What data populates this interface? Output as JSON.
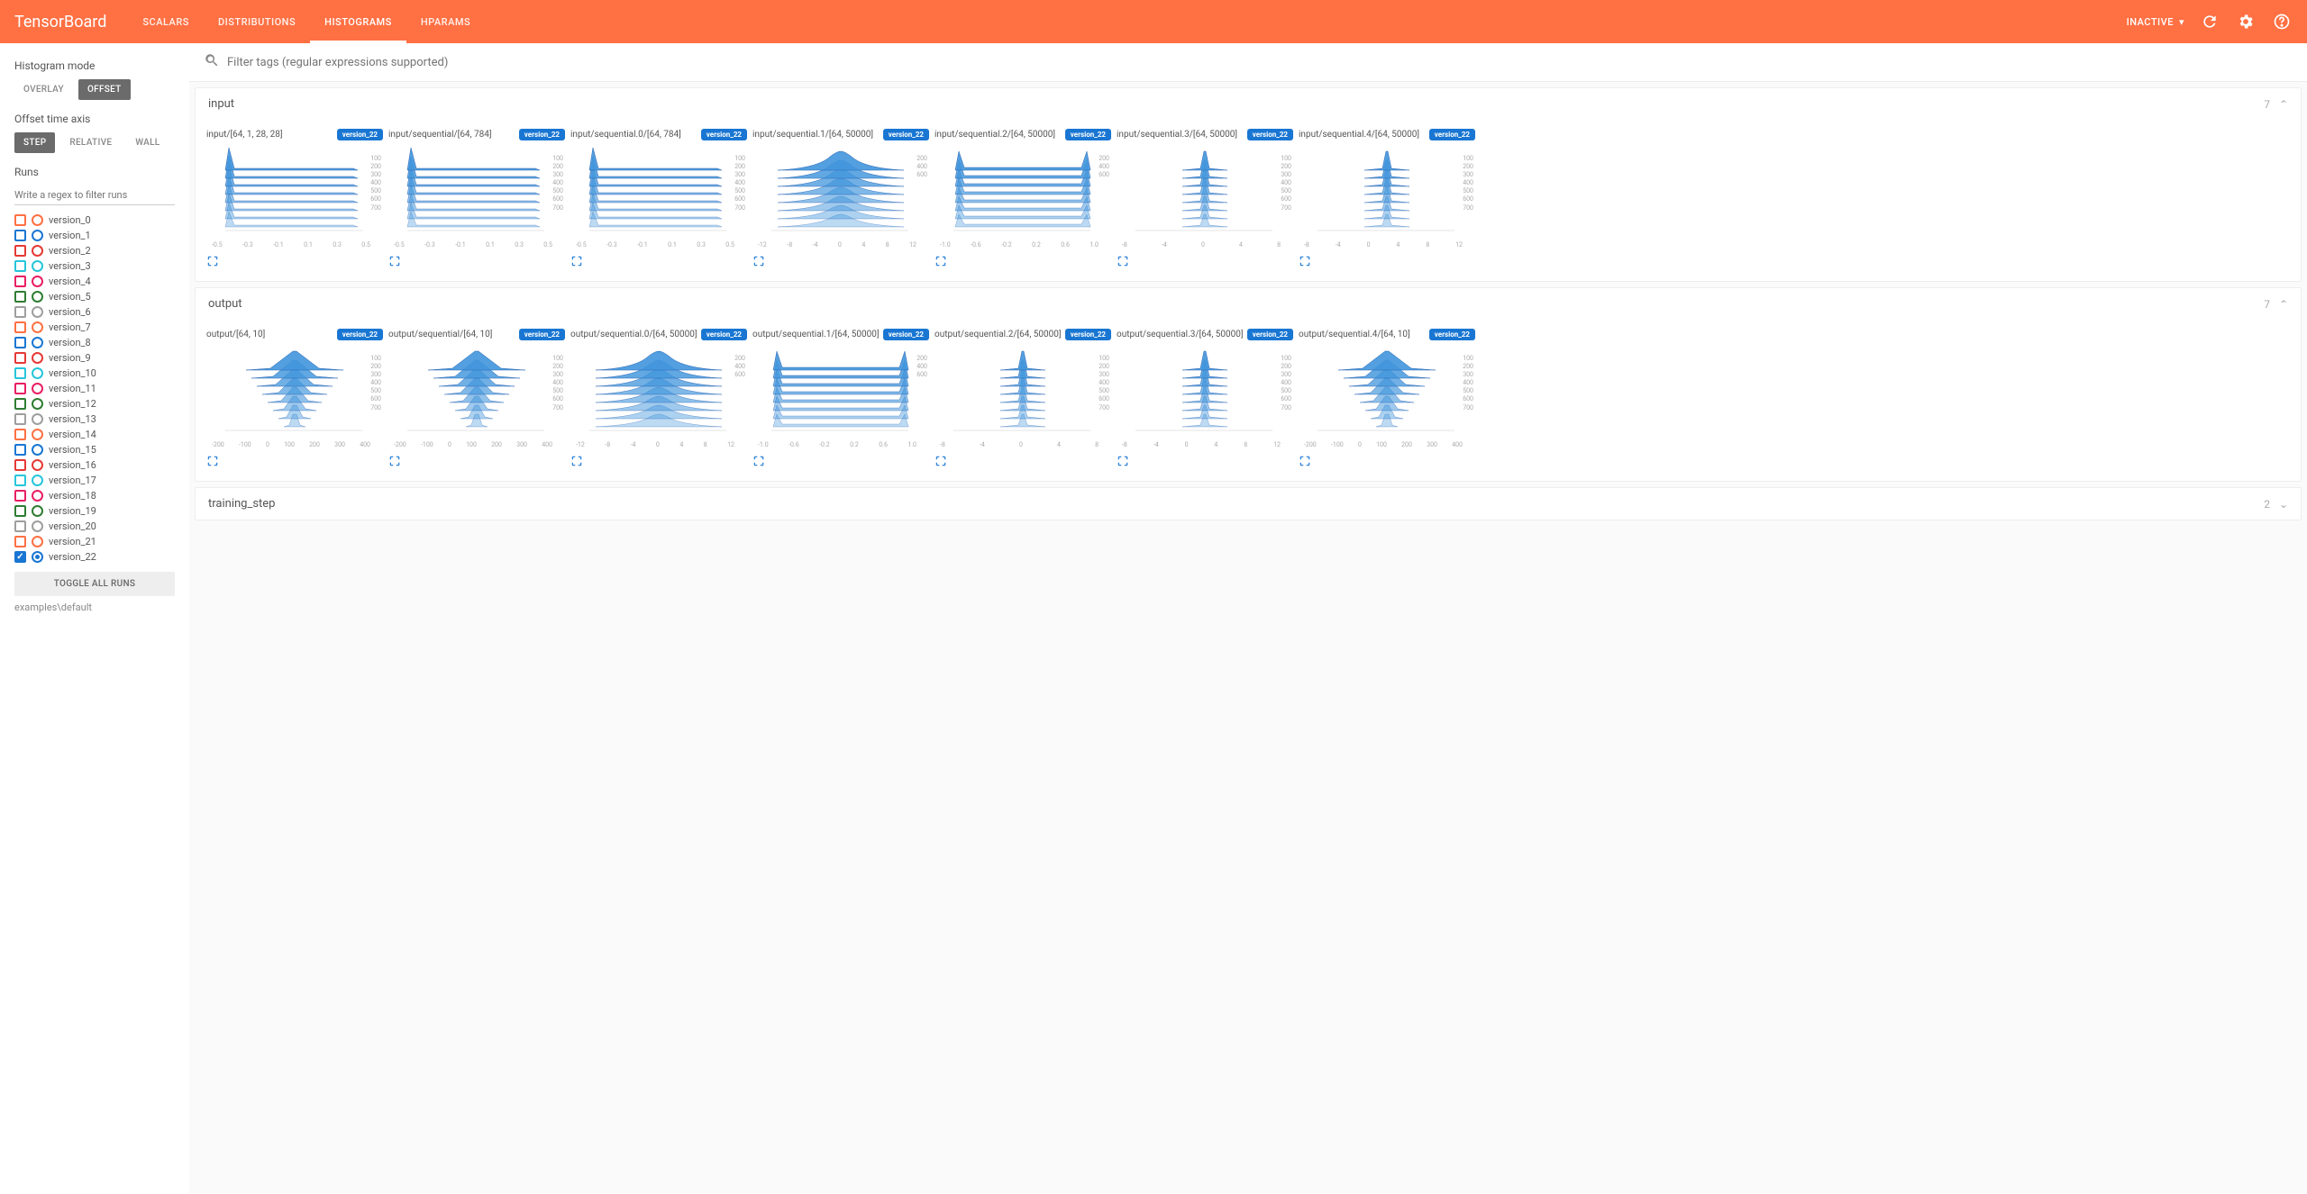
{
  "header": {
    "logo": "TensorBoard",
    "tabs": [
      "SCALARS",
      "DISTRIBUTIONS",
      "HISTOGRAMS",
      "HPARAMS"
    ],
    "active_tab": 2,
    "status": "INACTIVE"
  },
  "sidebar": {
    "histogram_mode_label": "Histogram mode",
    "histogram_modes": [
      "OVERLAY",
      "OFFSET"
    ],
    "histogram_mode_active": 1,
    "offset_time_label": "Offset time axis",
    "offset_modes": [
      "STEP",
      "RELATIVE",
      "WALL"
    ],
    "offset_mode_active": 0,
    "runs_label": "Runs",
    "runs_filter_placeholder": "Write a regex to filter runs",
    "runs": [
      {
        "name": "version_0",
        "color": "#ff7043",
        "checked": false,
        "radio": false
      },
      {
        "name": "version_1",
        "color": "#1976d2",
        "checked": false,
        "radio": false
      },
      {
        "name": "version_2",
        "color": "#e53935",
        "checked": false,
        "radio": false
      },
      {
        "name": "version_3",
        "color": "#26c6da",
        "checked": false,
        "radio": false
      },
      {
        "name": "version_4",
        "color": "#e91e63",
        "checked": false,
        "radio": false
      },
      {
        "name": "version_5",
        "color": "#2e7d32",
        "checked": false,
        "radio": false
      },
      {
        "name": "version_6",
        "color": "#9e9e9e",
        "checked": false,
        "radio": false
      },
      {
        "name": "version_7",
        "color": "#ff7043",
        "checked": false,
        "radio": false
      },
      {
        "name": "version_8",
        "color": "#1976d2",
        "checked": false,
        "radio": false
      },
      {
        "name": "version_9",
        "color": "#e53935",
        "checked": false,
        "radio": false
      },
      {
        "name": "version_10",
        "color": "#26c6da",
        "checked": false,
        "radio": false
      },
      {
        "name": "version_11",
        "color": "#e91e63",
        "checked": false,
        "radio": false
      },
      {
        "name": "version_12",
        "color": "#2e7d32",
        "checked": false,
        "radio": false
      },
      {
        "name": "version_13",
        "color": "#9e9e9e",
        "checked": false,
        "radio": false
      },
      {
        "name": "version_14",
        "color": "#ff7043",
        "checked": false,
        "radio": false
      },
      {
        "name": "version_15",
        "color": "#1976d2",
        "checked": false,
        "radio": false
      },
      {
        "name": "version_16",
        "color": "#e53935",
        "checked": false,
        "radio": false
      },
      {
        "name": "version_17",
        "color": "#26c6da",
        "checked": false,
        "radio": false
      },
      {
        "name": "version_18",
        "color": "#e91e63",
        "checked": false,
        "radio": false
      },
      {
        "name": "version_19",
        "color": "#2e7d32",
        "checked": false,
        "radio": false
      },
      {
        "name": "version_20",
        "color": "#9e9e9e",
        "checked": false,
        "radio": false
      },
      {
        "name": "version_21",
        "color": "#ff7043",
        "checked": false,
        "radio": false
      },
      {
        "name": "version_22",
        "color": "#1976d2",
        "checked": true,
        "radio": true
      }
    ],
    "toggle_all": "TOGGLE ALL RUNS",
    "path": "examples\\default"
  },
  "search": {
    "placeholder": "Filter tags (regular expressions supported)"
  },
  "groups": [
    {
      "name": "input",
      "charts": [
        {
          "title": "input/[64, 1, 28, 28]",
          "badge": "version_22",
          "xticks": [
            "-0.5",
            "-0.3",
            "-0.1",
            "0.1",
            "0.3",
            "0.5"
          ],
          "yticks": [
            "100",
            "200",
            "300",
            "400",
            "500",
            "600",
            "700"
          ],
          "shape": "spike-left"
        },
        {
          "title": "input/sequential/[64, 784]",
          "badge": "version_22",
          "xticks": [
            "-0.5",
            "-0.3",
            "-0.1",
            "0.1",
            "0.3",
            "0.5"
          ],
          "yticks": [
            "100",
            "200",
            "300",
            "400",
            "500",
            "600",
            "700"
          ],
          "shape": "spike-left"
        },
        {
          "title": "input/sequential.0/[64, 784]",
          "badge": "version_22",
          "xticks": [
            "-0.5",
            "-0.3",
            "-0.1",
            "0.1",
            "0.3",
            "0.5"
          ],
          "yticks": [
            "100",
            "200",
            "300",
            "400",
            "500",
            "600",
            "700"
          ],
          "shape": "spike-left"
        },
        {
          "title": "input/sequential.1/[64, 50000]",
          "badge": "version_22",
          "xticks": [
            "-12",
            "-8",
            "-4",
            "0",
            "4",
            "8",
            "12"
          ],
          "yticks": [
            "200",
            "400",
            "600"
          ],
          "shape": "bell"
        },
        {
          "title": "input/sequential.2/[64, 50000]",
          "badge": "version_22",
          "xticks": [
            "-1.0",
            "-0.6",
            "-0.2",
            "0.2",
            "0.6",
            "1.0"
          ],
          "yticks": [
            "200",
            "400",
            "600"
          ],
          "shape": "uwide"
        },
        {
          "title": "input/sequential.3/[64, 50000]",
          "badge": "version_22",
          "xticks": [
            "-8",
            "-4",
            "0",
            "4",
            "8"
          ],
          "yticks": [
            "100",
            "200",
            "300",
            "400",
            "500",
            "600",
            "700"
          ],
          "shape": "narrow"
        },
        {
          "title": "input/sequential.4/[64, 50000]",
          "badge": "version_22",
          "xticks": [
            "-8",
            "-4",
            "0",
            "4",
            "8",
            "12"
          ],
          "yticks": [
            "100",
            "200",
            "300",
            "400",
            "500",
            "600",
            "700"
          ],
          "shape": "narrow"
        }
      ]
    },
    {
      "name": "output",
      "charts": [
        {
          "title": "output/[64, 10]",
          "badge": "version_22",
          "xticks": [
            "-200",
            "-100",
            "0",
            "100",
            "200",
            "300",
            "400"
          ],
          "yticks": [
            "100",
            "200",
            "300",
            "400",
            "500",
            "600",
            "700"
          ],
          "shape": "narrow-wide"
        },
        {
          "title": "output/sequential/[64, 10]",
          "badge": "version_22",
          "xticks": [
            "-200",
            "-100",
            "0",
            "100",
            "200",
            "300",
            "400"
          ],
          "yticks": [
            "100",
            "200",
            "300",
            "400",
            "500",
            "600",
            "700"
          ],
          "shape": "narrow-wide"
        },
        {
          "title": "output/sequential.0/[64, 50000]",
          "badge": "version_22",
          "xticks": [
            "-12",
            "-8",
            "-4",
            "0",
            "4",
            "8",
            "12"
          ],
          "yticks": [
            "200",
            "400",
            "600"
          ],
          "shape": "bell"
        },
        {
          "title": "output/sequential.1/[64, 50000]",
          "badge": "version_22",
          "xticks": [
            "-1.0",
            "-0.6",
            "-0.2",
            "0.2",
            "0.6",
            "1.0"
          ],
          "yticks": [
            "200",
            "400",
            "600"
          ],
          "shape": "uwide"
        },
        {
          "title": "output/sequential.2/[64, 50000]",
          "badge": "version_22",
          "xticks": [
            "-8",
            "-4",
            "0",
            "4",
            "8"
          ],
          "yticks": [
            "100",
            "200",
            "300",
            "400",
            "500",
            "600",
            "700"
          ],
          "shape": "narrow"
        },
        {
          "title": "output/sequential.3/[64, 50000]",
          "badge": "version_22",
          "xticks": [
            "-8",
            "-4",
            "0",
            "4",
            "8",
            "12"
          ],
          "yticks": [
            "100",
            "200",
            "300",
            "400",
            "500",
            "600",
            "700"
          ],
          "shape": "narrow"
        },
        {
          "title": "output/sequential.4/[64, 10]",
          "badge": "version_22",
          "xticks": [
            "-200",
            "-100",
            "0",
            "100",
            "200",
            "300",
            "400"
          ],
          "yticks": [
            "100",
            "200",
            "300",
            "400",
            "500",
            "600",
            "700"
          ],
          "shape": "narrow-wide"
        }
      ]
    },
    {
      "name": "training_step",
      "collapsed": true,
      "count": "2"
    }
  ],
  "chart_data": {
    "type": "histogram-offset",
    "note": "Stacked histogram ridges per step (offset mode). Approximate shapes extracted visually.",
    "steps": [
      100,
      200,
      300,
      400,
      500,
      600,
      700
    ],
    "charts": {
      "input/[64, 1, 28, 28]": {
        "xrange": [
          -0.5,
          0.5
        ],
        "shape": "spike at -0.5 with flat tail"
      },
      "input/sequential/[64, 784]": {
        "xrange": [
          -0.5,
          0.5
        ],
        "shape": "spike at -0.5 with flat tail"
      },
      "input/sequential.0/[64, 784]": {
        "xrange": [
          -0.5,
          0.5
        ],
        "shape": "spike at -0.5 with flat tail"
      },
      "input/sequential.1/[64, 50000]": {
        "xrange": [
          -12,
          12
        ],
        "shape": "gaussian bell centered at 0"
      },
      "input/sequential.2/[64, 50000]": {
        "xrange": [
          -1.0,
          1.0
        ],
        "shape": "U-shaped peaks at ±1"
      },
      "input/sequential.3/[64, 50000]": {
        "xrange": [
          -8,
          8
        ],
        "shape": "narrow spike at 0"
      },
      "input/sequential.4/[64, 50000]": {
        "xrange": [
          -8,
          12
        ],
        "shape": "narrow spike at 0"
      },
      "output/[64, 10]": {
        "xrange": [
          -200,
          400
        ],
        "shape": "narrow spike near 0 widening base"
      },
      "output/sequential/[64, 10]": {
        "xrange": [
          -200,
          400
        ],
        "shape": "narrow spike near 0 widening base"
      },
      "output/sequential.0/[64, 50000]": {
        "xrange": [
          -12,
          12
        ],
        "shape": "gaussian bell centered at 0"
      },
      "output/sequential.1/[64, 50000]": {
        "xrange": [
          -1.0,
          1.0
        ],
        "shape": "U-shaped peaks at ±1"
      },
      "output/sequential.2/[64, 50000]": {
        "xrange": [
          -8,
          8
        ],
        "shape": "narrow spike at 0"
      },
      "output/sequential.3/[64, 50000]": {
        "xrange": [
          -8,
          12
        ],
        "shape": "narrow spike at 0"
      },
      "output/sequential.4/[64, 10]": {
        "xrange": [
          -200,
          400
        ],
        "shape": "narrow spike near 0 widening base"
      }
    }
  }
}
